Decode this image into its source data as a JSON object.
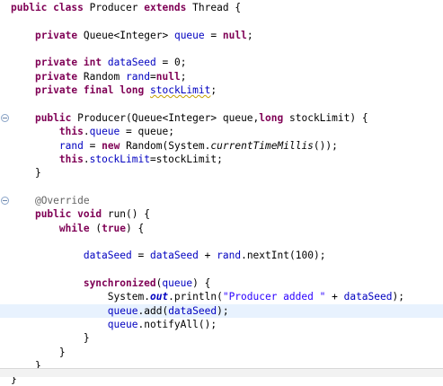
{
  "editor": {
    "language": "java",
    "highlighted_line": 23,
    "fold_markers_at_lines": [
      9,
      15
    ],
    "lines": [
      {
        "text": "public class Producer extends Thread {"
      },
      {
        "text": ""
      },
      {
        "text": "    private Queue<Integer> queue = null;"
      },
      {
        "text": ""
      },
      {
        "text": "    private int dataSeed = 0;"
      },
      {
        "text": "    private Random rand=null;"
      },
      {
        "text": "    private final long stockLimit;"
      },
      {
        "text": ""
      },
      {
        "text": "    public Producer(Queue<Integer> queue,long stockLimit) {"
      },
      {
        "text": "        this.queue = queue;"
      },
      {
        "text": "        rand = new Random(System.currentTimeMillis());"
      },
      {
        "text": "        this.stockLimit=stockLimit;"
      },
      {
        "text": "    }"
      },
      {
        "text": ""
      },
      {
        "text": "    @Override"
      },
      {
        "text": "    public void run() {"
      },
      {
        "text": "        while (true) {"
      },
      {
        "text": ""
      },
      {
        "text": "            dataSeed = dataSeed + rand.nextInt(100);"
      },
      {
        "text": ""
      },
      {
        "text": "            synchronized(queue) {"
      },
      {
        "text": "                System.out.println(\"Producer added \" + dataSeed);"
      },
      {
        "text": "                queue.add(dataSeed);"
      },
      {
        "text": "                queue.notifyAll();"
      },
      {
        "text": "            }"
      },
      {
        "text": "        }"
      },
      {
        "text": "    }"
      },
      {
        "text": "}"
      }
    ]
  },
  "colors": {
    "keyword": "#7f0055",
    "field": "#0000c0",
    "string": "#2a00ff",
    "annotation": "#646464",
    "current_line": "#e8f2fe"
  },
  "icons": {
    "fold_marker": "collapse-minus-icon"
  }
}
